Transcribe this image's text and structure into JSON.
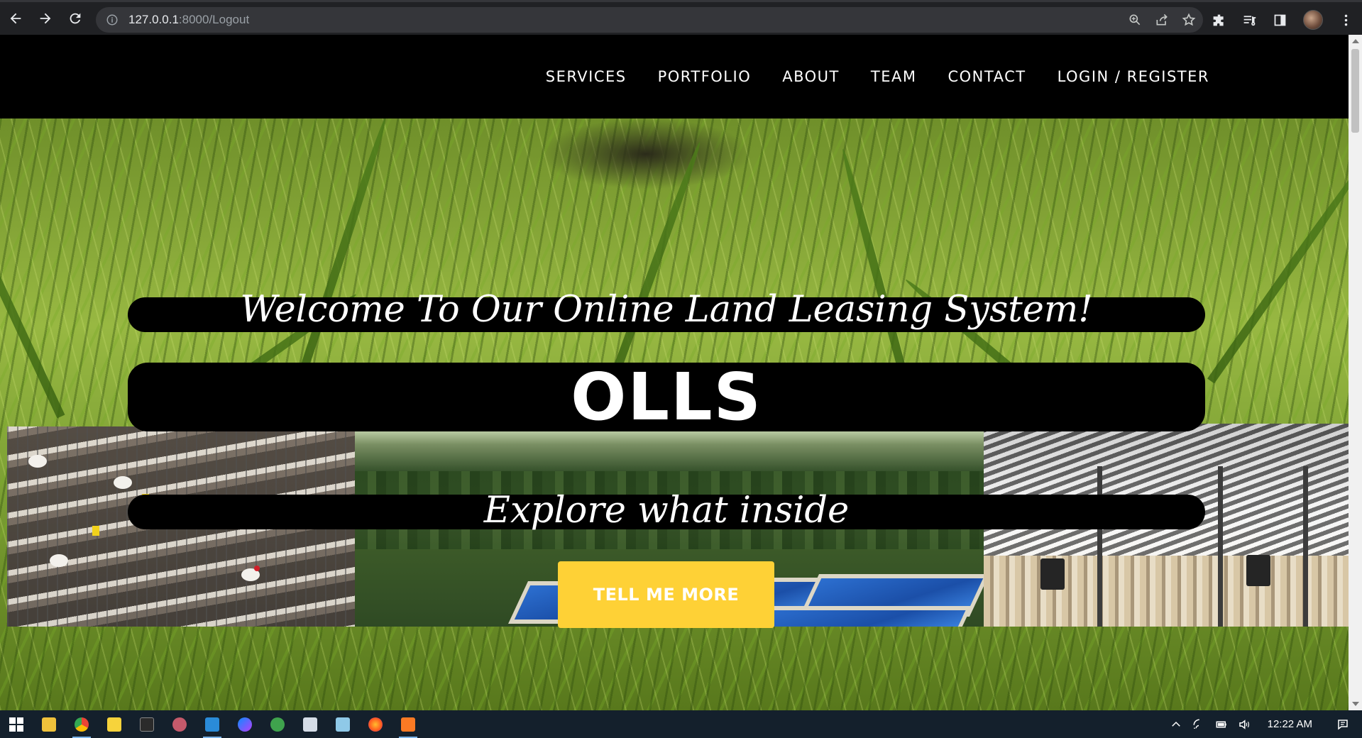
{
  "browser": {
    "url_host": "127.0.0.1",
    "url_path": ":8000/Logout"
  },
  "nav": {
    "links": [
      "SERVICES",
      "PORTFOLIO",
      "ABOUT",
      "TEAM",
      "CONTACT",
      "LOGIN / REGISTER"
    ]
  },
  "hero": {
    "welcome": "Welcome To Our Online Land Leasing System!",
    "brand": "OLLS",
    "explore": "Explore what inside",
    "cta": "TELL ME MORE"
  },
  "taskbar": {
    "clock": "12:22 AM"
  },
  "colors": {
    "accent": "#fed136",
    "navbar": "#000000"
  }
}
